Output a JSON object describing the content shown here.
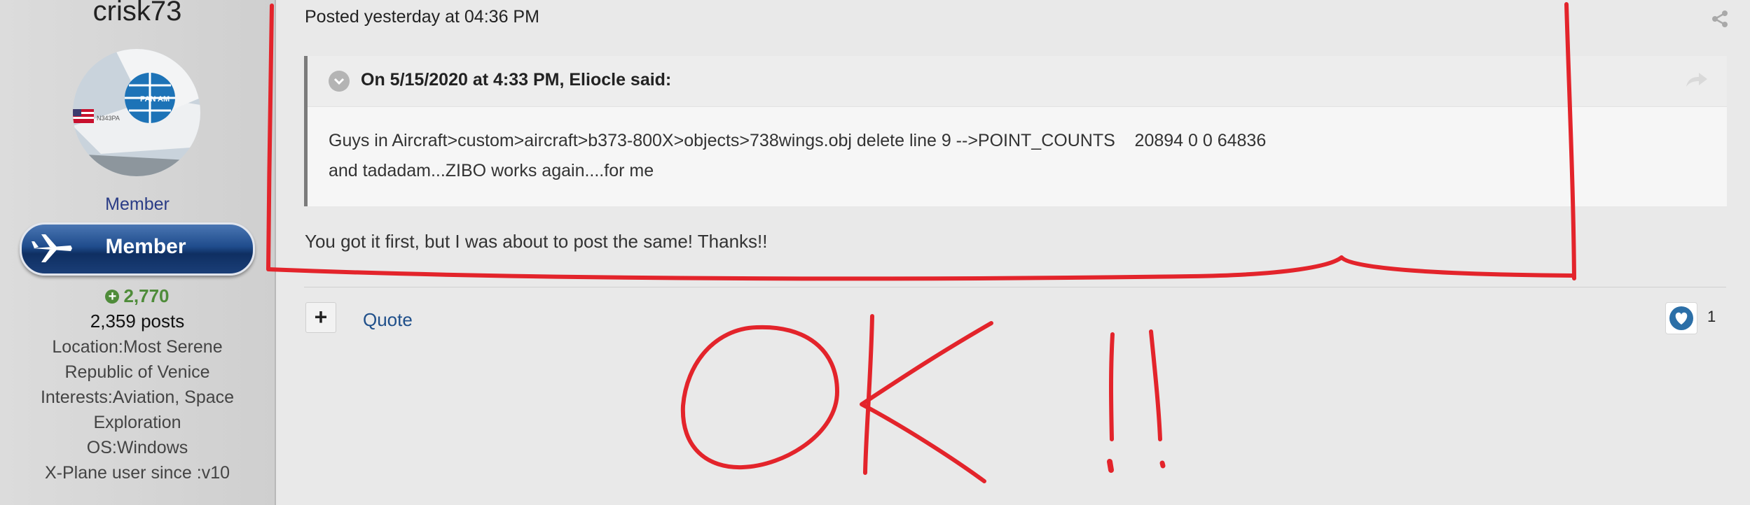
{
  "author": {
    "name": "crisk73",
    "avatar_label": "N343PA",
    "title": "Member",
    "badge_label": "Member",
    "reputation": "2,770",
    "posts": "2,359 posts",
    "info_lines": [
      "Location:Most Serene",
      "Republic of Venice",
      "Interests:Aviation, Space",
      "Exploration",
      "OS:Windows",
      "X-Plane user since :v10"
    ]
  },
  "post": {
    "date": "Posted yesterday at 04:36 PM",
    "quote": {
      "citation": "On 5/15/2020 at 4:33 PM, Eliocle said:",
      "line1": "Guys in Aircraft>custom>aircraft>b373-800X>objects>738wings.obj delete line 9 -->POINT_COUNTS    20894 0 0 64836",
      "line2": "and tadadam...ZIBO works again....for me"
    },
    "body": "You got it first, but I was about to post the same! Thanks!!",
    "actions": {
      "multiquote_label": "+",
      "quote_label": "Quote"
    },
    "reaction_count": "1"
  },
  "colors": {
    "annotation": "#e3242b",
    "reputation": "#4f8c3a",
    "link": "#1f4f8a",
    "member_title": "#2a3c86"
  },
  "icons": [
    "share-icon",
    "chevron-down-icon",
    "reply-arrow-icon",
    "heart-icon",
    "plane-icon"
  ]
}
